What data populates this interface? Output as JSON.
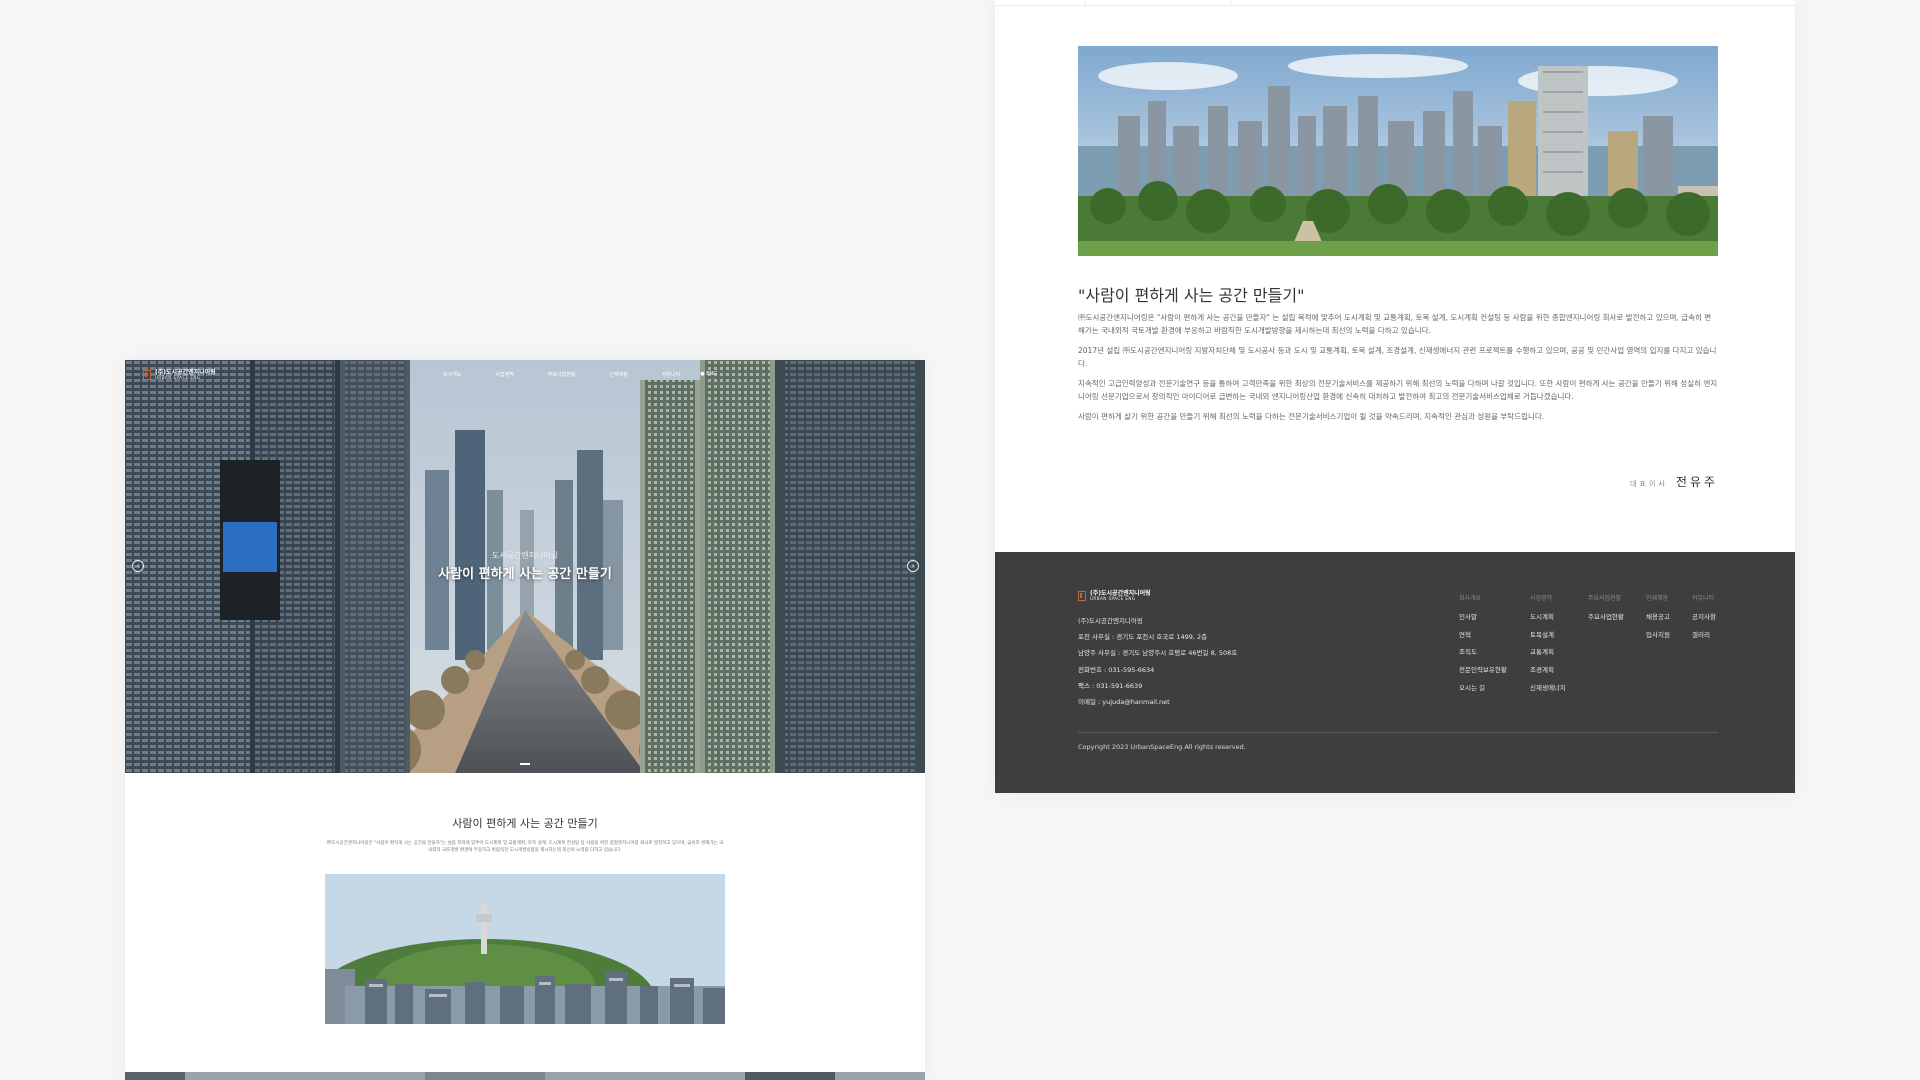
{
  "home": {
    "nav": {
      "logo_ko": "(주)도시공간엔지니어링",
      "logo_en": "URBAN SPACE ENG",
      "menu": [
        "회사개요",
        "사업영역",
        "주요사업현황",
        "인재채용",
        "커뮤니티"
      ],
      "util": "●  ENG"
    },
    "hero": {
      "subtitle": "도시공간엔지니어링",
      "title": "사람이 편하게 사는 공간 만들기",
      "prev_icon": "chevron-left-icon",
      "next_icon": "chevron-right-icon"
    },
    "intro": {
      "title": "사람이 편하게 사는 공간 만들기",
      "text": "㈜도시공간엔지니어링은 \"사람이 편하게 사는 공간을 만들자\"는 설립 목적에 맞추어 도시계획 및 교통계획, 토목 설계, 도시계획 컨설팅 등 사람을 위한 종합엔지니어링 회사로 발전하고 있으며, 급속히 변해가는 국내외적 국토개발 환경에 부응하고 바람직한 도시개발방향을 제시하는데 최선의 노력을 다하고 있습니다."
    }
  },
  "about": {
    "heading": "\"사람이 편하게 사는 공간 만들기\"",
    "paragraphs": [
      "㈜도시공간엔지니어링은 \"사람이 편하게 사는 공간을 만들자\" 는 설립 목적에 맞추어 도시계획 및 교통계획, 토목 설계, 도시계획 컨설팅 등 사람을 위한 종합엔지니어링 회사로 발전하고 있으며, 급속히 변해가는 국내외적 국토개발 환경에 부응하고 바람직한 도시개발방향을 제시하는데 최선의 노력을 다하고 있습니다.",
      "2017년 설립 ㈜도시공간엔지니어링 지방자치단체 및 도시공사 등과 도시 및 교통계획, 토목 설계, 조경설계, 신재생에너지 관련 프로젝트를 수행하고 있으며, 공공 및 민간사업 영역의 입지를 다지고 있습니다.",
      "지속적인 고급인력양성과 전문기술연구 등을 통하여 고객만족을 위한 최상의 전문기술서비스를 제공하기 위해 최선의 노력을 다하며 나갈 것입니다. 또한 사람이 편하게 사는 공간을 만들기 위해 성실히 엔지니어링 선문기업으로서 창의적인 아이디어로 급변하는 국내외 엔지니어링산업 환경에 신속히 대처하고 발전하여 최고의 전문기술서비스업체로 거듭나겠습니다.",
      "사람이 편하게 살기 위한 공간을 만들기 위해 최선의 노력을 다하는 전문기술서비스기업이 될 것을 약속드리며, 지속적인 관심과 성원을 부탁드립니다."
    ],
    "signature_role": "대표이사",
    "signature_name": "전유주"
  },
  "footer": {
    "logo_ko": "(주)도시공간엔지니어링",
    "logo_en": "URBAN SPACE ENG",
    "info": [
      "(주)도시공간엔지니어링",
      "포천 사무실 : 경기도 포천시 호국로 1499, 2층",
      "남양주 사무실 : 경기도 남양주시 호평로 46번길 8, 508호",
      "전화번호 : 031-595-6634",
      "팩스 : 031-591-6639",
      "이메일 : yujuda@hanmail.net"
    ],
    "columns": [
      {
        "heading": "회사개요",
        "items": [
          "인사말",
          "연혁",
          "조직도",
          "전문인력보유현황",
          "오시는 길"
        ]
      },
      {
        "heading": "사업영역",
        "items": [
          "도시계획",
          "토목설계",
          "교통계획",
          "조경계획",
          "신재생에너지"
        ]
      },
      {
        "heading": "주요사업현황",
        "items": [
          "주요사업현황"
        ]
      },
      {
        "heading": "인재채용",
        "items": [
          "채용공고",
          "입사지원"
        ]
      },
      {
        "heading": "커뮤니티",
        "items": [
          "공지사항",
          "갤러리"
        ]
      }
    ],
    "copyright": "Copyright 2023 UrbanSpaceEng All rights reserved."
  },
  "colors": {
    "page_background": "#f6f6f6",
    "footer_background": "#3f3e3e",
    "brand_accent": "#c8643a"
  }
}
